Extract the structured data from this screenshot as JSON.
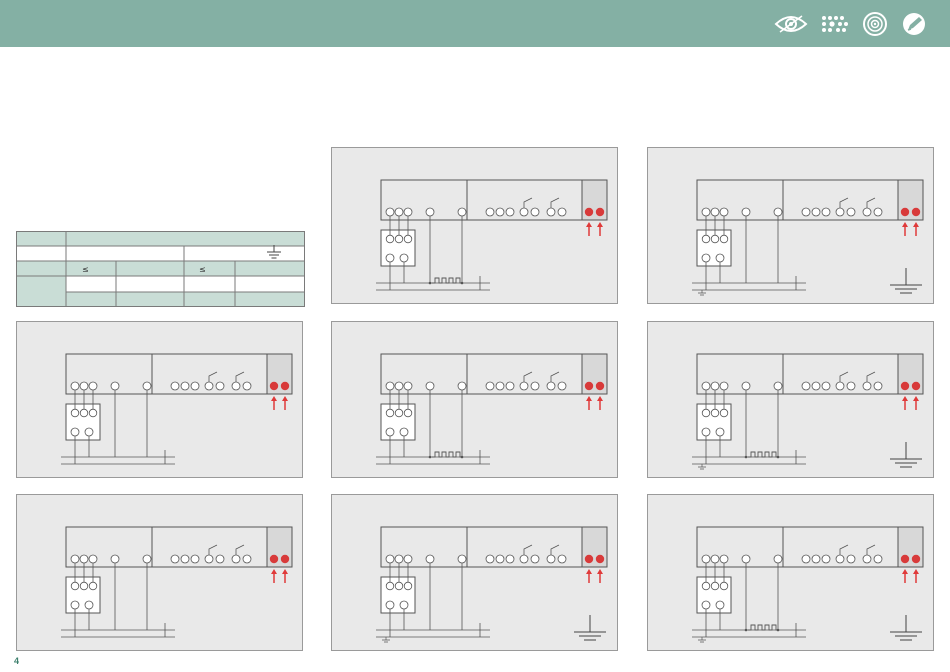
{
  "page": {
    "number": "4"
  },
  "colors": {
    "header": "#84b0a4",
    "table_accent": "#c9ddd6",
    "panel_bg": "#e9e9e9",
    "led": "#d83a3a",
    "arrow": "#e03a3a",
    "line": "#555555"
  },
  "header": {
    "icons": [
      "eye-icon",
      "dot-matrix-icon",
      "target-icon",
      "pencil-circle-icon"
    ]
  },
  "table": {
    "symbols": {
      "le_1": "≤",
      "le_2": "≤"
    },
    "has_ground_symbol": true
  },
  "panels": [
    {
      "id": "A",
      "wiring": "heater",
      "ground_symbol": false
    },
    {
      "id": "B",
      "wiring": "plain",
      "ground_symbol": true
    },
    {
      "id": "C",
      "wiring": "plain",
      "ground_symbol": false
    },
    {
      "id": "D",
      "wiring": "heater",
      "ground_symbol": false
    },
    {
      "id": "E",
      "wiring": "heater",
      "ground_symbol": true
    },
    {
      "id": "F",
      "wiring": "plain",
      "ground_symbol": false
    },
    {
      "id": "G",
      "wiring": "plain",
      "ground_symbol": true
    },
    {
      "id": "H",
      "wiring": "heater",
      "ground_symbol": true
    }
  ]
}
